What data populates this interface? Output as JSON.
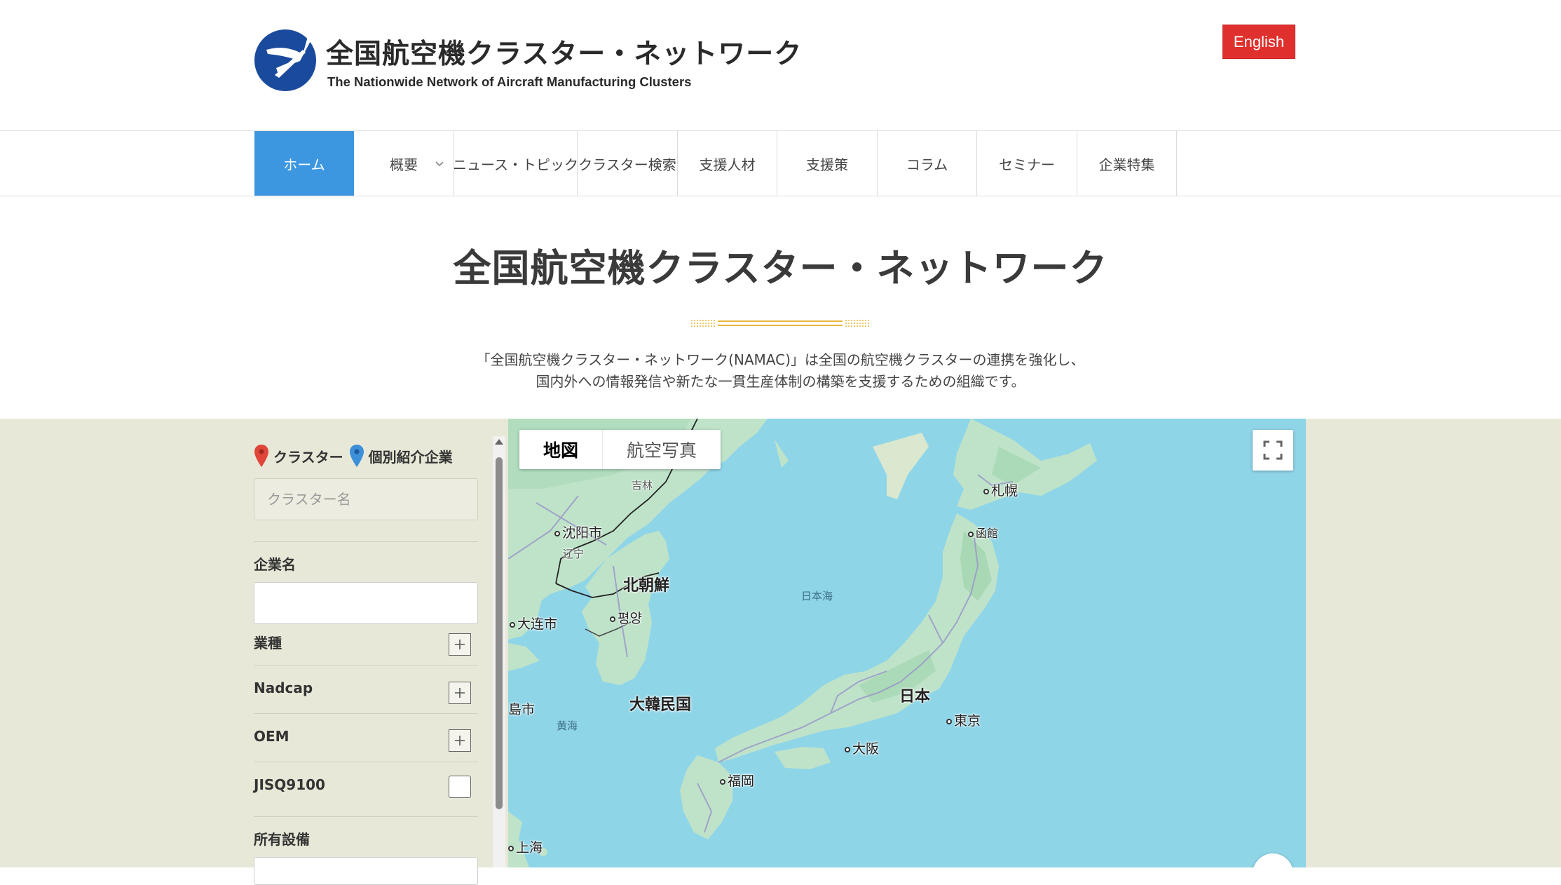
{
  "header": {
    "logo_title": "全国航空機クラスター・ネットワーク",
    "logo_subtitle": "The Nationwide Network of Aircraft Manufacturing Clusters",
    "lang_button": "English"
  },
  "nav": {
    "items": [
      {
        "label": "ホーム",
        "active": true
      },
      {
        "label": "概要",
        "has_dropdown": true
      },
      {
        "label": "ニュース・トピック"
      },
      {
        "label": "クラスター検索"
      },
      {
        "label": "支援人材"
      },
      {
        "label": "支援策"
      },
      {
        "label": "コラム"
      },
      {
        "label": "セミナー"
      },
      {
        "label": "企業特集"
      }
    ]
  },
  "intro": {
    "title": "全国航空機クラスター・ネットワーク",
    "line1": "「全国航空機クラスター・ネットワーク(NAMAC)」は全国の航空機クラスターの連携を強化し、",
    "line2": "国内外への情報発信や新たな一貫生産体制の構築を支援するための組織です。"
  },
  "search": {
    "legend_cluster": "クラスター",
    "legend_company": "個別紹介企業",
    "cluster_placeholder": "クラスター名",
    "company_label": "企業名",
    "company_value": "",
    "filters": [
      {
        "label": "業種",
        "control": "plus"
      },
      {
        "label": "Nadcap",
        "control": "plus"
      },
      {
        "label": "OEM",
        "control": "plus"
      },
      {
        "label": "JISQ9100",
        "control": "checkbox",
        "checked": false
      }
    ],
    "equipment_label": "所有設備"
  },
  "map": {
    "type_map": "地図",
    "type_satellite": "航空写真",
    "labels": {
      "jilin": "吉林",
      "shenyang": "沈阳市",
      "liaoning": "辽宁",
      "north_korea": "北朝鮮",
      "pyongyang": "평양",
      "dalian": "大连市",
      "south_korea": "大韓民国",
      "qingdao_fragment": "島市",
      "yellow_sea": "黄海",
      "sea_of_japan": "日本海",
      "sapporo": "札幌",
      "hakodate": "函館",
      "japan": "日本",
      "tokyo": "東京",
      "osaka": "大阪",
      "fukuoka": "福岡",
      "shanghai": "上海"
    },
    "colors": {
      "water": "#8fd5e8",
      "land": "#bfe3c9",
      "land_dark": "#9fd3ad",
      "road": "#9a98c8"
    }
  },
  "colors": {
    "accent": "#3c97e0",
    "lang_button": "#e0302d",
    "search_bg": "#e8e8d8",
    "pin_cluster": "#e0463a",
    "pin_company": "#3c8fd8",
    "divider": "#e8b53a"
  }
}
